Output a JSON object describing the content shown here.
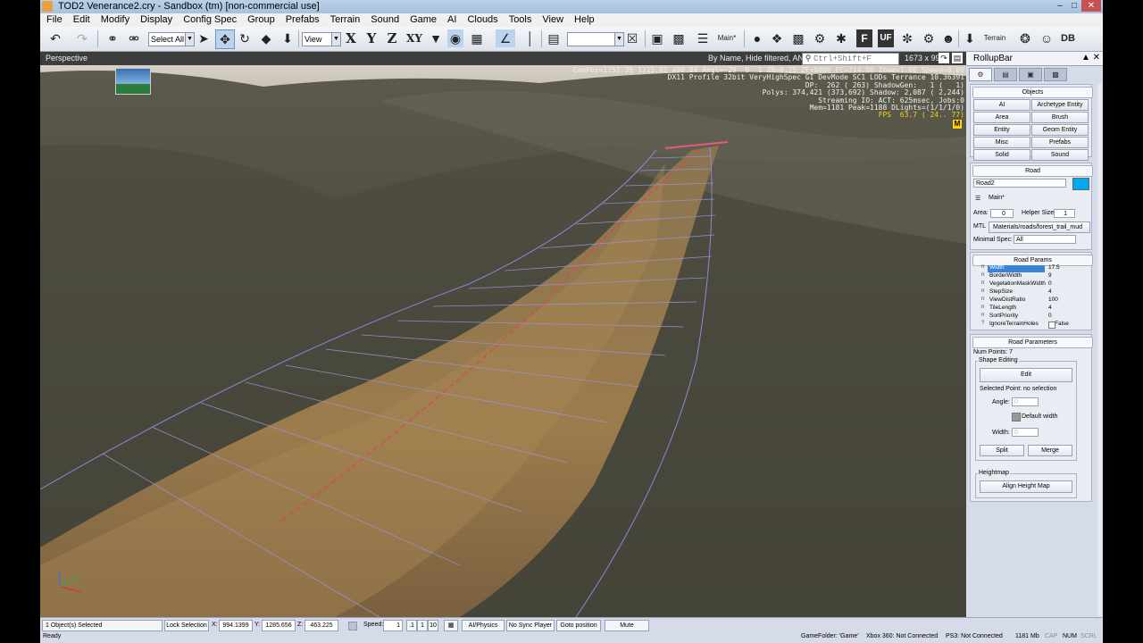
{
  "window": {
    "title": "TOD2 Venerance2.cry - Sandbox (tm) [non-commercial use]"
  },
  "menu": [
    "File",
    "Edit",
    "Modify",
    "Display",
    "Config Spec",
    "Group",
    "Prefabs",
    "Terrain",
    "Sound",
    "Game",
    "AI",
    "Clouds",
    "Tools",
    "View",
    "Help"
  ],
  "toolbar": {
    "select_all": "Select All",
    "coord_system": "View",
    "x_label": "X",
    "y_label": "Y",
    "z_label": "Z",
    "xy_label": "XY",
    "layer": "Main*",
    "f_label": "F",
    "uf_label": "UF",
    "terrain_label": "Terrain",
    "db_label": "DB"
  },
  "viewport": {
    "name": "Perspective",
    "filter_text": "By Name, Hide filtered, AND",
    "search_placeholder": "Ctrl+Shift+F",
    "resolution": "1673 x 995",
    "hud_lines": [
      "CamPos=1152.36 1215.02 480.84 Angl=-29  0  1 ZN=0.25 ZF=8000 FC=214.88 Zoom=1.00 Speed=0.00",
      "DX11 Profile 32bit VeryHighSpec GI DevMode SC1 LODs Terrance 10.36391",
      "DP:  262 ( 263) ShadowGen:   1 (   1)",
      "Polys: 374,421 (373,692) Shadow: 2,087 ( 2,244)",
      "Streaming IO: ACT: 625msec, Jobs:0",
      "Mem=1181 Peak=1188 DLights=(1/1/1/0)"
    ],
    "fps": "FPS  63.7 ( 24.. 77)",
    "badge": "M"
  },
  "rollup": {
    "title": "RollupBar",
    "objects_header": "Objects",
    "object_buttons": [
      "AI",
      "Archetype Entity",
      "Area",
      "Brush",
      "Entity",
      "Geom Entity",
      "Misc",
      "Prefabs",
      "Solid",
      "Sound"
    ],
    "road_header": "Road",
    "road_name": "Road2",
    "road_color": "#00aaee",
    "layer": "Main*",
    "area_label": "Area:",
    "area_value": "0",
    "helper_label": "Helper Size:",
    "helper_value": "1",
    "mtl_label": "MTL",
    "mtl_value": "Materials/roads/forest_trail_mud",
    "min_spec_label": "Minimal Spec:",
    "min_spec_value": "All",
    "road_params_header": "Road Params",
    "params": [
      {
        "name": "Width",
        "value": "17.5"
      },
      {
        "name": "BorderWidth",
        "value": "9"
      },
      {
        "name": "VegetationMaskWidth",
        "value": "0"
      },
      {
        "name": "StepSize",
        "value": "4"
      },
      {
        "name": "ViewDistRatio",
        "value": "100"
      },
      {
        "name": "TileLength",
        "value": "4"
      },
      {
        "name": "SortPriority",
        "value": "0"
      },
      {
        "name": "IgnoreTerrainHoles",
        "value": "False"
      }
    ],
    "road_parameters_header": "Road Parameters",
    "num_points": "Num Points: 7",
    "shape_editing": "Shape Editing",
    "edit_button": "Edit",
    "selected_point": "Selected Point: no selection",
    "angle_label": "Angle:",
    "angle_value": "0",
    "default_width": "Default width",
    "width_label": "Width:",
    "width_value": "0",
    "split_button": "Split",
    "merge_button": "Merge",
    "heightmap_label": "Heightmap",
    "align_button": "Align Height Map"
  },
  "status": {
    "selected": "1 Object(s) Selected",
    "lock_selection": "Lock Selection",
    "x_label": "X:",
    "x_value": "994.1399",
    "y_label": "Y:",
    "y_value": "1285.656",
    "z_label": "Z:",
    "z_value": "463.225",
    "speed_label": "Speed:",
    "speed_value": "1",
    "speed_1": ".1",
    "speed_2": "1",
    "speed_3": "10",
    "ai_physics": "AI/Physics",
    "no_sync": "No Sync Player",
    "goto": "Goto position",
    "mute": "Mute"
  },
  "info": {
    "ready": "Ready",
    "game_folder": "GameFolder: 'Game'",
    "xbox": "Xbox 360: Not Connected",
    "ps3": "PS3: Not Connected",
    "mem": "1181 Mb",
    "cap": "CAP",
    "num": "NUM",
    "scrl": "SCRL"
  }
}
